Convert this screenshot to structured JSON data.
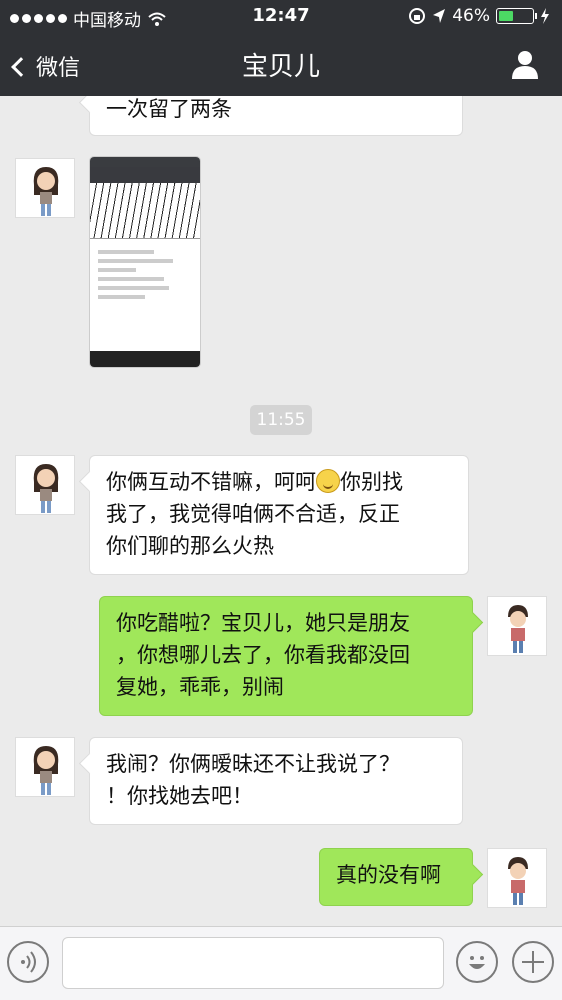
{
  "status_bar": {
    "carrier": "中国移动",
    "time": "12:47",
    "battery_percent": "46%",
    "battery_level": 0.46,
    "icons": [
      "signal-dots-icon",
      "wifi-icon",
      "orientation-lock-icon",
      "location-icon",
      "battery-icon",
      "charging-icon"
    ]
  },
  "nav": {
    "back_label": "微信",
    "title": "宝贝儿",
    "right_icon": "person-icon"
  },
  "messages": [
    {
      "side": "in",
      "type": "text",
      "text": "一次留了两条"
    },
    {
      "side": "in",
      "type": "image"
    },
    {
      "type": "timestamp",
      "text": "11:55"
    },
    {
      "side": "in",
      "type": "text",
      "lines": [
        "你俩互动不错嘛，呵呵",
        "你别找",
        "我了，我觉得咱俩不合适，反正",
        "你们聊的那么火热"
      ],
      "emoji": "smile-emoji"
    },
    {
      "side": "out",
      "type": "text",
      "lines": [
        "你吃醋啦？宝贝儿，她只是朋友",
        "，你想哪儿去了，你看我都没回",
        "复她，乖乖，别闹"
      ]
    },
    {
      "side": "in",
      "type": "text",
      "lines": [
        "我闹？你俩暧昧还不让我说了？",
        "！你找她去吧！"
      ]
    },
    {
      "side": "out",
      "type": "text",
      "text": "真的没有啊"
    }
  ],
  "input_bar": {
    "placeholder": "",
    "icons": [
      "voice-icon",
      "emoji-icon",
      "plus-icon"
    ]
  },
  "colors": {
    "nav_bg": "#2f3135",
    "chat_bg": "#ebebeb",
    "out_bubble": "#a0e75a",
    "in_bubble": "#ffffff",
    "battery_fill": "#4cd964"
  }
}
